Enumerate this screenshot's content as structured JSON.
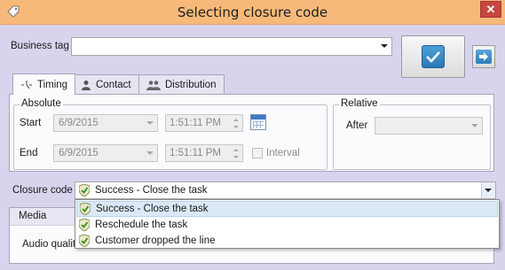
{
  "window": {
    "title": "Selecting closure code",
    "close_glyph": "✕"
  },
  "business_tag": {
    "label": "Business tag",
    "value": ""
  },
  "buttons": {
    "confirm": "confirm-check",
    "next": "next-arrow"
  },
  "tabs": [
    {
      "label": "Timing",
      "icon": "timer-icon",
      "active": true
    },
    {
      "label": "Contact",
      "icon": "person-icon",
      "active": false
    },
    {
      "label": "Distribution",
      "icon": "people-icon",
      "active": false
    }
  ],
  "timing": {
    "absolute_title": "Absolute",
    "start_label": "Start",
    "start_date": "6/9/2015",
    "start_time": "1:51:11 PM",
    "end_label": "End",
    "end_date": "6/9/2015",
    "end_time": "1:51:11 PM",
    "interval_label": "Interval",
    "relative_title": "Relative",
    "after_label": "After",
    "after_value": ""
  },
  "closure": {
    "label": "Closure code",
    "selected": "Success - Close the task",
    "options": [
      "Success - Close the task",
      "Reschedule the task",
      "Customer dropped the line"
    ]
  },
  "media": {
    "header": "Media",
    "audio_label": "Audio qualit"
  },
  "colors": {
    "titlebar": "#f7b97a",
    "close_button": "#c7463f",
    "body": "#d8d4ee",
    "accent_blue": "#2a79b8",
    "shield_green": "#4c9a2a"
  }
}
